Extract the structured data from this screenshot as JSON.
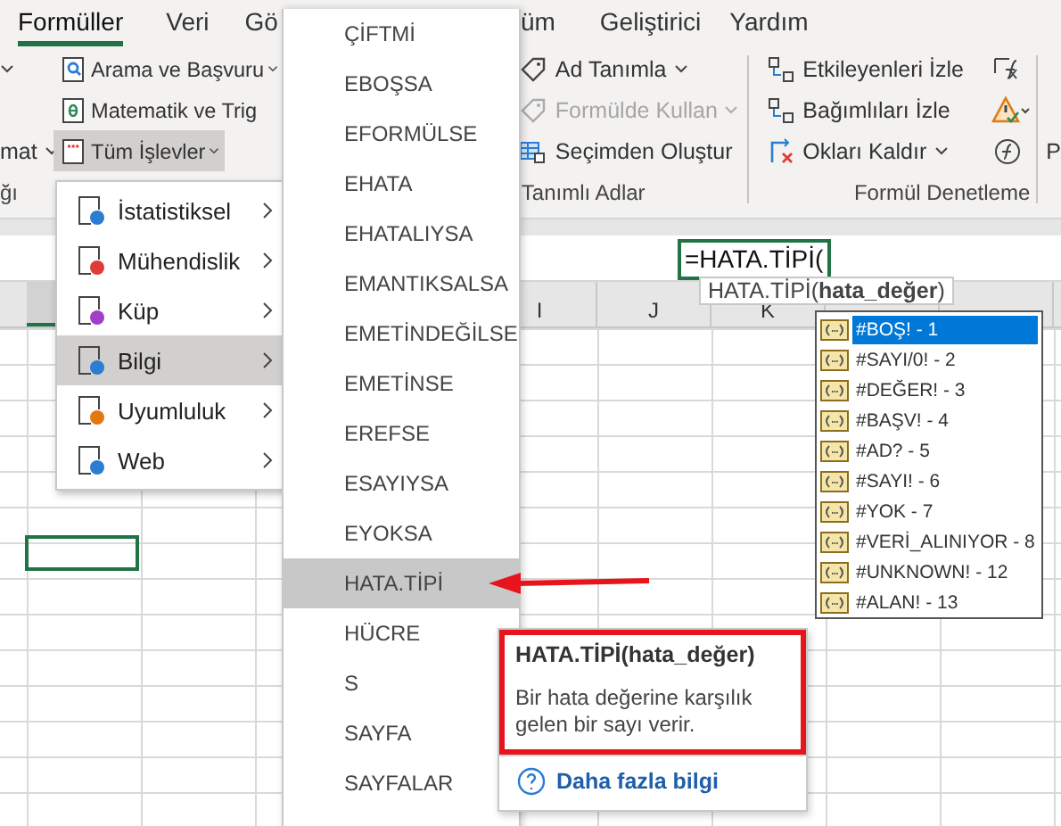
{
  "ribbon_tabs": [
    {
      "label": "Formüller",
      "selected": true
    },
    {
      "label": "Veri",
      "selected": false
    },
    {
      "label": "Gö",
      "selected": false
    },
    {
      "label": "üm",
      "selected": false
    },
    {
      "label": "Geliştirici",
      "selected": false
    },
    {
      "label": "Yardım",
      "selected": false
    }
  ],
  "function_library": {
    "left_cut": "mat",
    "group_label": "ğı",
    "commands": [
      {
        "label": "Arama ve Başvuru",
        "dropdown": true,
        "selected": false
      },
      {
        "label": "Matematik ve Trig",
        "dropdown": false,
        "selected": false
      },
      {
        "label": "Tüm İşlevler",
        "dropdown": true,
        "selected": true
      }
    ]
  },
  "defined_names": {
    "group_label": "Tanımlı Adlar",
    "commands": [
      {
        "label": "Ad Tanımla",
        "dropdown": true,
        "disabled": false
      },
      {
        "label": "Formülde Kullan",
        "dropdown": true,
        "disabled": true
      },
      {
        "label": "Seçimden Oluştur",
        "dropdown": false,
        "disabled": false
      }
    ]
  },
  "formula_auditing": {
    "group_label": "Formül Denetleme",
    "commands": [
      {
        "label": "Etkileyenleri İzle",
        "dropdown": false
      },
      {
        "label": "Bağımlıları İzle",
        "dropdown": false
      },
      {
        "label": "Okları Kaldır",
        "dropdown": true
      }
    ],
    "next_group_cut": "P"
  },
  "cell_editor": {
    "value": "=HATA.TİPİ("
  },
  "argument_tip": "HATA.TİPİ(**hata_değer**)",
  "columns": [
    {
      "label": "I"
    },
    {
      "label": "J"
    },
    {
      "label": "K"
    }
  ],
  "category_menu": [
    {
      "label": "İstatistiksel",
      "selected": false
    },
    {
      "label": "Mühendislik",
      "selected": false
    },
    {
      "label": "Küp",
      "selected": false
    },
    {
      "label": "Bilgi",
      "selected": true
    },
    {
      "label": "Uyumluluk",
      "selected": false
    },
    {
      "label": "Web",
      "selected": false
    }
  ],
  "function_menu": [
    {
      "label": "ÇİFTMİ",
      "selected": false
    },
    {
      "label": "EBOŞSA",
      "selected": false
    },
    {
      "label": "EFORMÜLSE",
      "selected": false
    },
    {
      "label": "EHATA",
      "selected": false
    },
    {
      "label": "EHATALIYSA",
      "selected": false
    },
    {
      "label": "EMANTIKSALSA",
      "selected": false
    },
    {
      "label": "EMETİNDEĞİLSE",
      "selected": false
    },
    {
      "label": "EMETİNSE",
      "selected": false
    },
    {
      "label": "EREFSE",
      "selected": false
    },
    {
      "label": "ESAYIYSA",
      "selected": false
    },
    {
      "label": "EYOKSA",
      "selected": false
    },
    {
      "label": "HATA.TİPİ",
      "selected": true
    },
    {
      "label": "HÜCRE",
      "selected": false
    },
    {
      "label": "S",
      "selected": false
    },
    {
      "label": "SAYFA",
      "selected": false
    },
    {
      "label": "SAYFALAR",
      "selected": false
    }
  ],
  "autocomplete": [
    {
      "label": "#BOŞ! - 1",
      "selected": true
    },
    {
      "label": "#SAYI/0! - 2",
      "selected": false
    },
    {
      "label": "#DEĞER! - 3",
      "selected": false
    },
    {
      "label": "#BAŞV! - 4",
      "selected": false
    },
    {
      "label": "#AD? - 5",
      "selected": false
    },
    {
      "label": "#SAYI! - 6",
      "selected": false
    },
    {
      "label": "#YOK - 7",
      "selected": false
    },
    {
      "label": "#VERİ_ALINIYOR - 8",
      "selected": false
    },
    {
      "label": "#UNKNOWN! - 12",
      "selected": false
    },
    {
      "label": "#ALAN! - 13",
      "selected": false
    }
  ],
  "function_tooltip": {
    "title": "HATA.TİPİ(hata_değer)",
    "description": "Bir hata değerine karşılık gelen bir sayı verir.",
    "link": "Daha fazla bilgi"
  }
}
